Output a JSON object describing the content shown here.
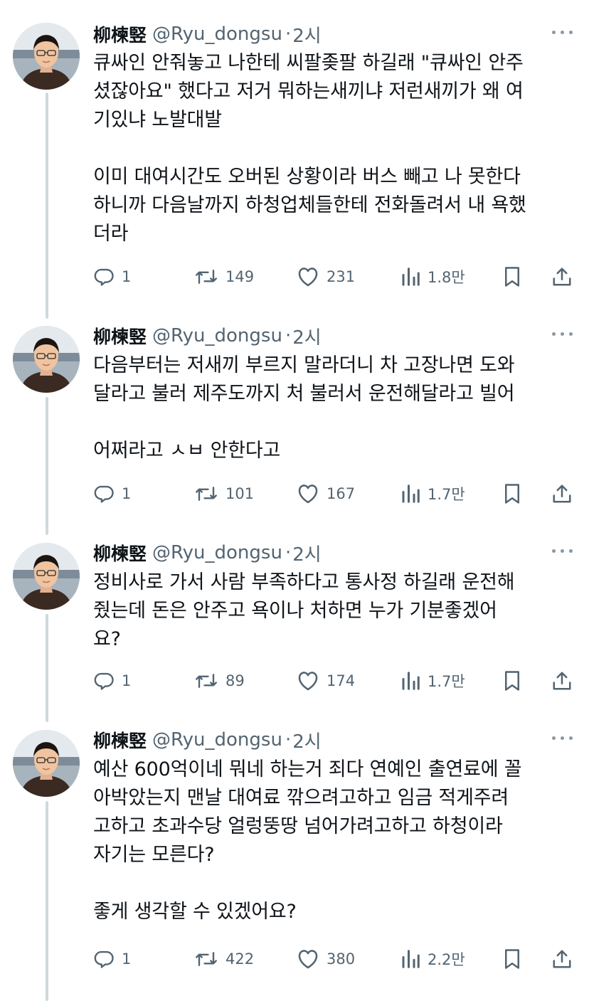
{
  "tweets": [
    {
      "name": "柳楝竪",
      "handle": "@Ryu_dongsu",
      "separator": "·",
      "time": "2시",
      "text": "큐싸인 안줘놓고 나한테 씨팔좆팔 하길래 \"큐싸인 안주\n셨잖아요\" 했다고 저거 뭐하는새끼냐 저런새끼가 왜 여\n기있냐 노발대발\n\n이미 대여시간도 오버된 상황이라 버스 빼고 나 못한다\n하니까 다음날까지 하청업체들한테 전화돌려서 내 욕했\n더라",
      "replies": "1",
      "retweets": "149",
      "likes": "231",
      "views": "1.8만"
    },
    {
      "name": "柳楝竪",
      "handle": "@Ryu_dongsu",
      "separator": "·",
      "time": "2시",
      "text": "다음부터는 저새끼 부르지 말라더니 차 고장나면 도와\n달라고 불러 제주도까지 처 불러서 운전해달라고 빌어\n\n어쩌라고 ㅅㅂ 안한다고",
      "replies": "1",
      "retweets": "101",
      "likes": "167",
      "views": "1.7만"
    },
    {
      "name": "柳楝竪",
      "handle": "@Ryu_dongsu",
      "separator": "·",
      "time": "2시",
      "text": "정비사로 가서 사람 부족하다고 통사정 하길래 운전해\n줬는데 돈은 안주고 욕이나 처하면 누가 기분좋겠어\n요?",
      "replies": "1",
      "retweets": "89",
      "likes": "174",
      "views": "1.7만"
    },
    {
      "name": "柳楝竪",
      "handle": "@Ryu_dongsu",
      "separator": "·",
      "time": "2시",
      "text": "예산 600억이네 뭐네 하는거 죄다 연예인 출연료에 꼴\n아박았는지 맨날 대여료 깎으려고하고 임금 적게주려\n고하고 초과수당 얼렁뚱땅 넘어가려고하고 하청이라\n자기는 모른다?\n\n좋게 생각할 수 있겠어요?",
      "replies": "1",
      "retweets": "422",
      "likes": "380",
      "views": "2.2만"
    }
  ],
  "icons": {
    "reply": "reply-icon",
    "retweet": "retweet-icon",
    "like": "heart-icon",
    "views": "views-chart-icon",
    "bookmark": "bookmark-icon",
    "share": "share-icon",
    "more": "more-icon"
  },
  "colors": {
    "text": "#0f1419",
    "secondary": "#536471",
    "thread_line": "#cfd9de",
    "background": "#ffffff"
  }
}
